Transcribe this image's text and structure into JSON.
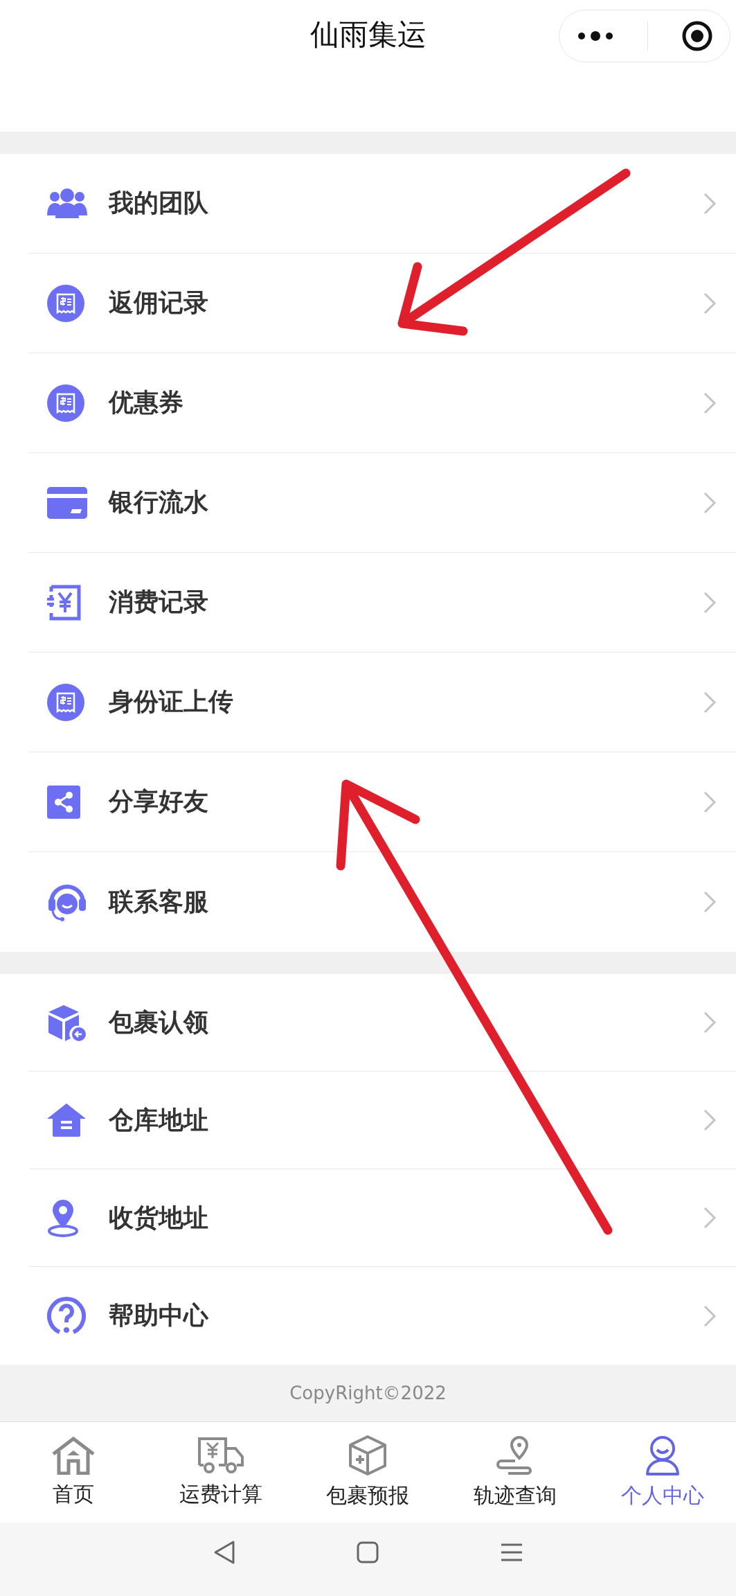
{
  "header": {
    "title": "仙雨集运"
  },
  "menu_groups": [
    {
      "items": [
        {
          "label": "我的团队"
        },
        {
          "label": "返佣记录"
        },
        {
          "label": "优惠券"
        },
        {
          "label": "银行流水"
        },
        {
          "label": "消费记录"
        },
        {
          "label": "身份证上传"
        },
        {
          "label": "分享好友"
        },
        {
          "label": "联系客服"
        }
      ]
    },
    {
      "items": [
        {
          "label": "包裹认领"
        },
        {
          "label": "仓库地址"
        },
        {
          "label": "收货地址"
        },
        {
          "label": "帮助中心"
        }
      ]
    }
  ],
  "footer": {
    "copyright": "CopyRight©2022"
  },
  "tabs": [
    {
      "label": "首页",
      "selected": false
    },
    {
      "label": "运费计算",
      "selected": false
    },
    {
      "label": "包裹预报",
      "selected": false
    },
    {
      "label": "轨迹查询",
      "selected": false
    },
    {
      "label": "个人中心",
      "selected": true
    }
  ]
}
